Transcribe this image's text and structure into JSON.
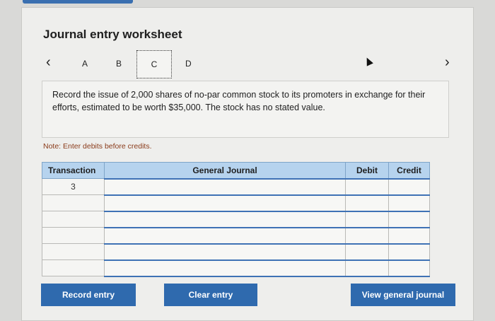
{
  "title": "Journal entry worksheet",
  "nav": {
    "prev_label": "‹",
    "next_label": "›",
    "tabs": [
      {
        "label": "A"
      },
      {
        "label": "B"
      },
      {
        "label": "C",
        "selected": true
      },
      {
        "label": "D"
      }
    ]
  },
  "instruction": "Record the issue of 2,000 shares of no-par common stock to its promoters in exchange for their efforts, estimated to be worth $35,000. The stock has no stated value.",
  "note": "Note: Enter debits before credits.",
  "table": {
    "headers": {
      "transaction": "Transaction",
      "general_journal": "General Journal",
      "debit": "Debit",
      "credit": "Credit"
    },
    "rows": [
      {
        "transaction": "3",
        "account": "",
        "debit": "",
        "credit": ""
      },
      {
        "transaction": "",
        "account": "",
        "debit": "",
        "credit": ""
      },
      {
        "transaction": "",
        "account": "",
        "debit": "",
        "credit": ""
      },
      {
        "transaction": "",
        "account": "",
        "debit": "",
        "credit": ""
      },
      {
        "transaction": "",
        "account": "",
        "debit": "",
        "credit": ""
      },
      {
        "transaction": "",
        "account": "",
        "debit": "",
        "credit": ""
      }
    ]
  },
  "buttons": {
    "record_entry": "Record entry",
    "clear_entry": "Clear entry",
    "view_general_journal": "View general journal"
  },
  "colors": {
    "button_blue": "#2f6aae",
    "header_blue": "#b6d3ee",
    "note_text": "#8a3b1a"
  }
}
